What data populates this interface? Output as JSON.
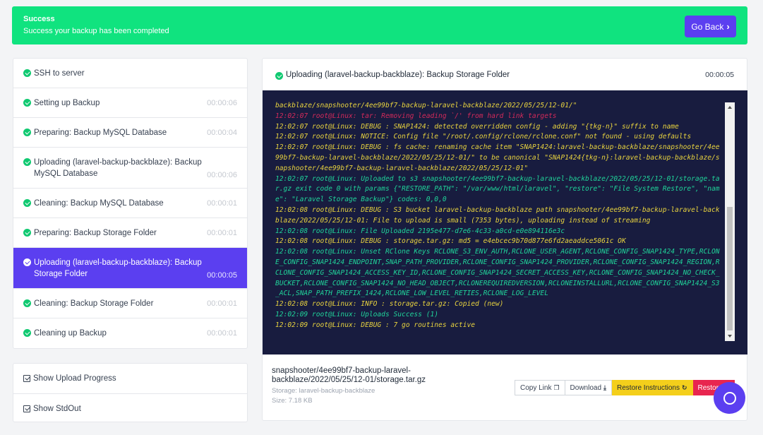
{
  "banner": {
    "title": "Success",
    "message": "Success your backup has been completed",
    "go_back_label": "Go Back"
  },
  "steps": [
    {
      "label": "SSH to server",
      "time": ""
    },
    {
      "label": "Setting up Backup",
      "time": "00:00:06"
    },
    {
      "label": "Preparing: Backup MySQL Database",
      "time": "00:00:04"
    },
    {
      "label": "Uploading (laravel-backup-backblaze): Backup MySQL Database",
      "time": "00:00:06"
    },
    {
      "label": "Cleaning: Backup MySQL Database",
      "time": "00:00:01"
    },
    {
      "label": "Preparing: Backup Storage Folder",
      "time": "00:00:01"
    },
    {
      "label": "Uploading (laravel-backup-backblaze): Backup Storage Folder",
      "time": "00:00:05"
    },
    {
      "label": "Cleaning: Backup Storage Folder",
      "time": "00:00:01"
    },
    {
      "label": "Cleaning up Backup",
      "time": "00:00:01"
    }
  ],
  "options": {
    "show_upload_progress": "Show Upload Progress",
    "show_stdout": "Show StdOut"
  },
  "detail": {
    "title": "Uploading (laravel-backup-backblaze): Backup Storage Folder",
    "duration": "00:00:05"
  },
  "log_lines": [
    {
      "color": "y",
      "text": "backblaze/snapshooter/4ee99bf7-backup-laravel-backblaze/2022/05/25/12-01/\""
    },
    {
      "color": "r",
      "text": "12:02:07 root@Linux: tar: Removing leading `/' from hard link targets"
    },
    {
      "color": "y",
      "text": "12:02:07 root@Linux: DEBUG : SNAP1424: detected overridden config - adding \"{tkg-n}\" suffix to name"
    },
    {
      "color": "y",
      "text": "12:02:07 root@Linux: NOTICE: Config file \"/root/.config/rclone/rclone.conf\" not found - using defaults"
    },
    {
      "color": "y",
      "text": "12:02:07 root@Linux: DEBUG : fs cache: renaming cache item \"SNAP1424:laravel-backup-backblaze/snapshooter/4ee99bf7-backup-laravel-backblaze/2022/05/25/12-01/\" to be canonical \"SNAP1424{tkg-n}:laravel-backup-backblaze/snapshooter/4ee99bf7-backup-laravel-backblaze/2022/05/25/12-01\""
    },
    {
      "color": "g",
      "text": "12:02:07 root@Linux: Uploaded to s3 snapshooter/4ee99bf7-backup-laravel-backblaze/2022/05/25/12-01/storage.tar.gz exit code 0 with params {\"RESTORE_PATH\": \"/var/www/html/laravel\", \"restore\": \"File System Restore\", \"name\": \"Laravel Storage Backup\"} codes: 0,0,0"
    },
    {
      "color": "y",
      "text": "12:02:08 root@Linux: DEBUG : S3 bucket laravel-backup-backblaze path snapshooter/4ee99bf7-backup-laravel-backblaze/2022/05/25/12-01: File to upload is small (7353 bytes), uploading instead of streaming"
    },
    {
      "color": "g",
      "text": "12:02:08 root@Linux: File Uploaded 2195e477-d7e6-4c33-a0cd-e0e894116e3c"
    },
    {
      "color": "y",
      "text": "12:02:08 root@Linux: DEBUG : storage.tar.gz: md5 = e4ebcec9b70d877e6fd2aeaddce5061c OK"
    },
    {
      "color": "g",
      "text": "12:02:08 root@Linux: Unset RClone Keys RCLONE_S3_ENV_AUTH,RCLONE_USER_AGENT,RCLONE_CONFIG_SNAP1424_TYPE,RCLONE_CONFIG_SNAP1424_ENDPOINT,SNAP_PATH_PROVIDER,RCLONE_CONFIG_SNAP1424_PROVIDER,RCLONE_CONFIG_SNAP1424_REGION,RCLONE_CONFIG_SNAP1424_ACCESS_KEY_ID,RCLONE_CONFIG_SNAP1424_SECRET_ACCESS_KEY,RCLONE_CONFIG_SNAP1424_NO_CHECK_BUCKET,RCLONE_CONFIG_SNAP1424_NO_HEAD_OBJECT,RCLONEREQUIREDVERSION,RCLONEINSTALLURL,RCLONE_CONFIG_SNAP1424_S3_ACL,SNAP_PATH_PREFIX_1424,RCLONE_LOW_LEVEL_RETIES,RCLONE_LOG_LEVEL"
    },
    {
      "color": "y",
      "text": "12:02:08 root@Linux: INFO : storage.tar.gz: Copied (new)"
    },
    {
      "color": "g",
      "text": "12:02:09 root@Linux: Uploads Success (1)"
    },
    {
      "color": "y",
      "text": "12:02:09 root@Linux: DEBUG : 7 go routines active"
    }
  ],
  "file": {
    "name": "snapshooter/4ee99bf7-backup-laravel-backblaze/2022/05/25/12-01/storage.tar.gz",
    "storage": "Storage: laravel-backup-backblaze",
    "size": "Size: 7.18 KB"
  },
  "actions": {
    "copy_link": "Copy Link",
    "download": "Download",
    "restore_instructions": "Restore Instructions",
    "restore": "Restore"
  },
  "colors": {
    "success_green": "#10e37f",
    "primary_purple": "#5b3ff0",
    "terminal_bg": "#181c3f",
    "restore_instructions": "#f4cf1b",
    "restore": "#e8254f"
  }
}
